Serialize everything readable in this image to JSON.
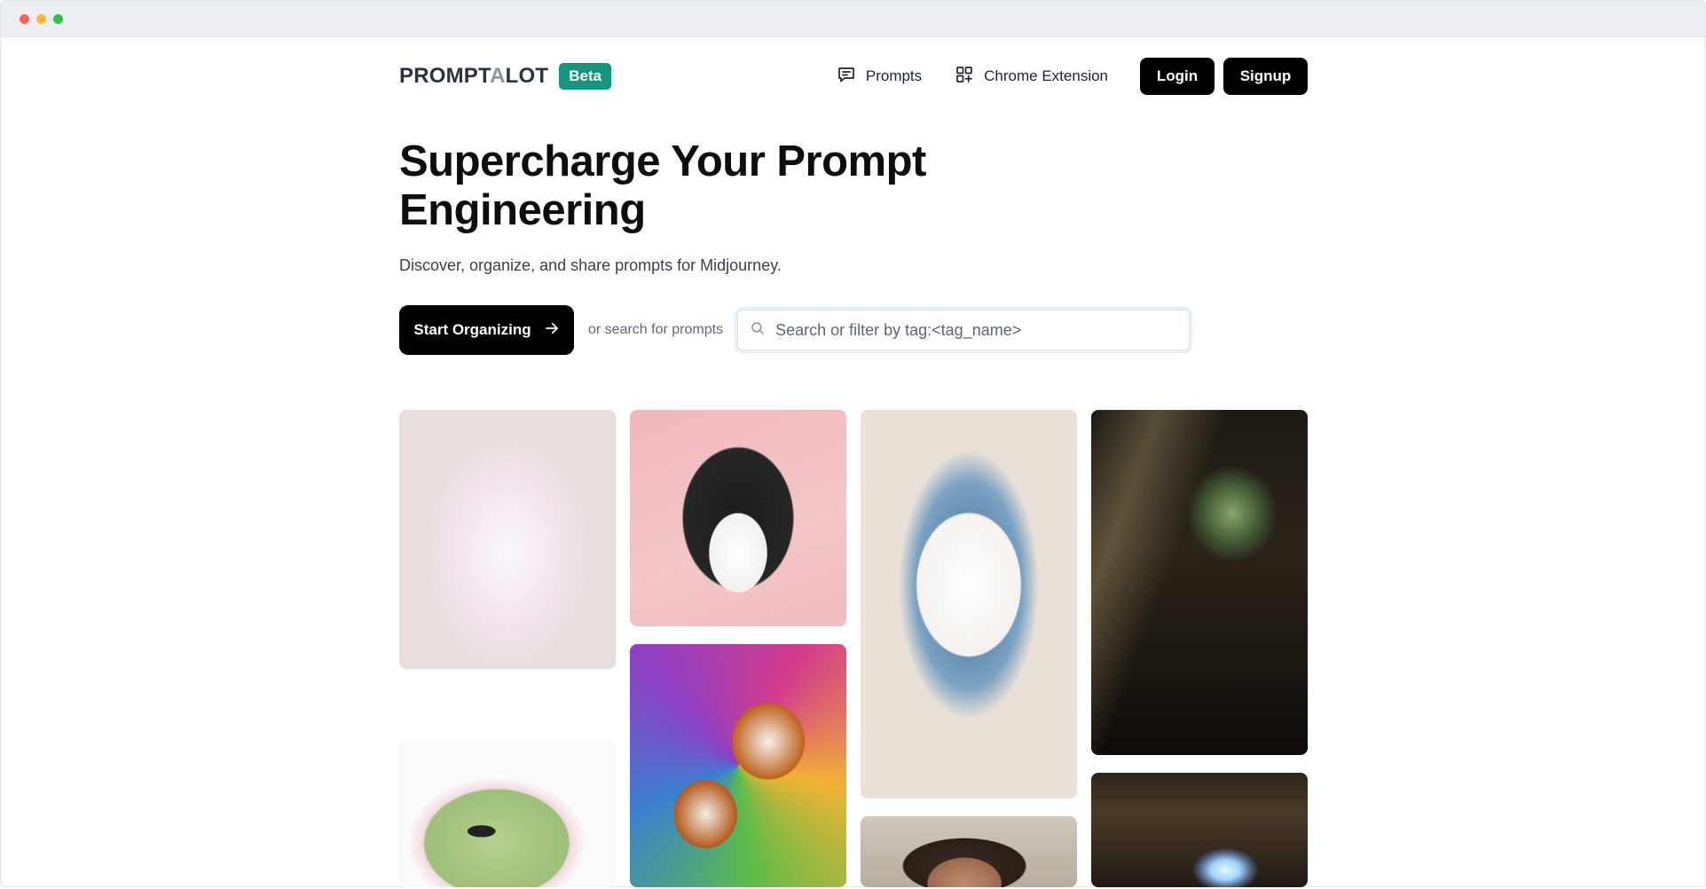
{
  "brand": {
    "logo_text_before": "PROMPT",
    "logo_text_a": "A",
    "logo_text_after": "LOT",
    "badge": "Beta"
  },
  "nav": {
    "prompts_label": "Prompts",
    "chrome_extension_label": "Chrome Extension",
    "login_label": "Login",
    "signup_label": "Signup"
  },
  "hero": {
    "title": "Supercharge Your Prompt Engineering",
    "subtitle": "Discover, organize, and share prompts for Midjourney."
  },
  "cta": {
    "start_label": "Start Organizing",
    "or_text": "or search for prompts",
    "search_placeholder": "Search or filter by tag:<tag_name>",
    "search_value": ""
  },
  "gallery": {
    "items": [
      {
        "icon": "cat-sticker-image"
      },
      {
        "icon": "boston-terrier-image"
      },
      {
        "icon": "snowman-image"
      },
      {
        "icon": "kitchen-window-image"
      },
      {
        "icon": "frog-sticker-image"
      },
      {
        "icon": "beagles-flowers-image"
      },
      {
        "icon": "man-portrait-image"
      },
      {
        "icon": "crystal-room-image"
      }
    ]
  },
  "colors": {
    "accent_badge": "#14957f",
    "button_dark": "#000000",
    "text_primary": "#0d0d0d",
    "text_muted": "#616977"
  },
  "window": {
    "controls": [
      "close",
      "minimize",
      "maximize"
    ]
  }
}
